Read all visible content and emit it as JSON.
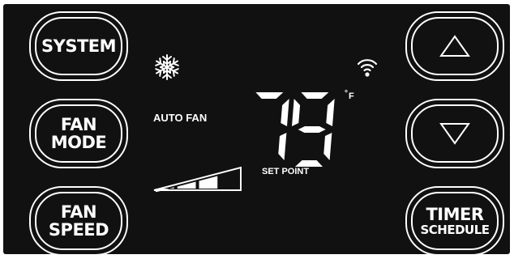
{
  "buttons": {
    "system": "SYSTEM",
    "fan_mode": [
      "FAN",
      "MODE"
    ],
    "fan_speed": [
      "FAN",
      "SPEED"
    ],
    "timer_schedule": [
      "TIMER",
      "SCHEDULE"
    ]
  },
  "display": {
    "fan_mode_text": "AUTO FAN",
    "temperature": "79",
    "unit": "F",
    "degree_symbol": "°",
    "setpoint_label": "SET POINT",
    "fan_speed_level": 3,
    "fan_speed_max": 4
  },
  "icons": {
    "mode": "snowflake-icon",
    "connectivity": "wifi-icon",
    "up": "up-arrow-icon",
    "down": "down-arrow-icon"
  },
  "colors": {
    "background": "#111111",
    "foreground": "#ffffff"
  }
}
